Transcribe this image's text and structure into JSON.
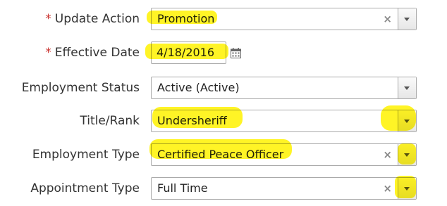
{
  "form": {
    "fields": [
      {
        "label": "Update Action",
        "required": "*",
        "value": "Promotion",
        "clear": "×"
      },
      {
        "label": "Effective Date",
        "required": "*",
        "value": "4/18/2016",
        "icon": "calendar-icon"
      },
      {
        "label": "Employment Status",
        "value": "Active (Active)"
      },
      {
        "label": "Title/Rank",
        "value": "Undersheriff"
      },
      {
        "label": "Employment Type",
        "value": "Certified Peace Officer",
        "clear": "×"
      },
      {
        "label": "Appointment Type",
        "value": "Full Time",
        "clear": "×"
      }
    ]
  },
  "colors": {
    "required_marker": "#c9302c",
    "highlight": "#fff200",
    "border": "#aaaaaa"
  }
}
